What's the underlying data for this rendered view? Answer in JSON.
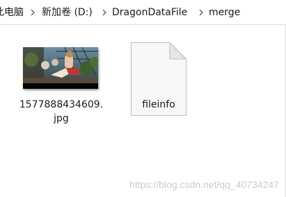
{
  "breadcrumb": {
    "items": [
      {
        "label": "此电脑"
      },
      {
        "label": "新加卷 (D:)"
      },
      {
        "label": "DragonDataFile"
      },
      {
        "label": "merge"
      }
    ],
    "separator_icon": "chevron-right-icon"
  },
  "files": [
    {
      "name": "1577888434609.jpg",
      "type": "image",
      "icon": "image-thumbnail"
    },
    {
      "name": "fileinfo",
      "type": "file",
      "icon": "blank-document-icon"
    }
  ],
  "watermark": {
    "text": "https://blog.csdn.net/qq_40734247"
  },
  "colors": {
    "window_bg": "#ffffff",
    "border": "#d9d9d9",
    "text": "#1a1a1a",
    "watermark": "#a0a0a0"
  }
}
